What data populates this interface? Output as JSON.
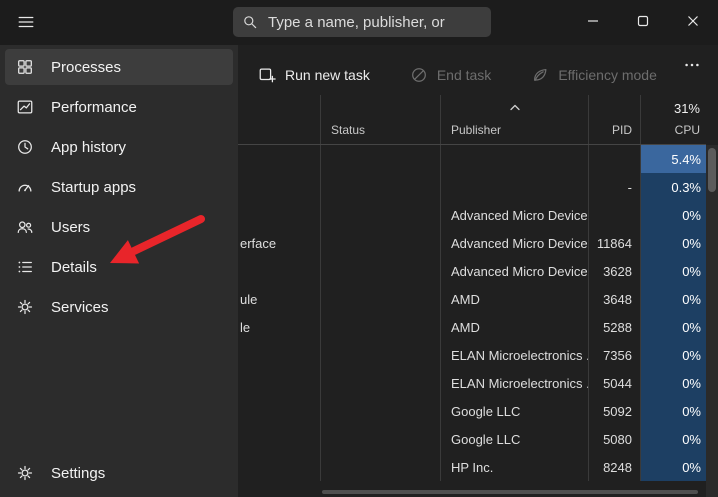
{
  "titlebar": {
    "search": {
      "placeholder": "Type a name, publisher, or"
    },
    "window_controls": [
      "minimize-icon",
      "maximize-icon",
      "close-icon"
    ]
  },
  "sidebar": {
    "items": [
      {
        "label": "Processes",
        "icon": "processes-icon",
        "selected": true
      },
      {
        "label": "Performance",
        "icon": "performance-icon",
        "selected": false
      },
      {
        "label": "App history",
        "icon": "app-history-icon",
        "selected": false
      },
      {
        "label": "Startup apps",
        "icon": "startup-apps-icon",
        "selected": false
      },
      {
        "label": "Users",
        "icon": "users-icon",
        "selected": false
      },
      {
        "label": "Details",
        "icon": "details-icon",
        "selected": false
      },
      {
        "label": "Services",
        "icon": "services-icon",
        "selected": false
      }
    ],
    "footer_item": {
      "label": "Settings",
      "icon": "settings-icon",
      "selected": false
    }
  },
  "toolbar": {
    "buttons": [
      {
        "label": "Run new task",
        "icon": "run-new-task-icon",
        "enabled": true
      },
      {
        "label": "End task",
        "icon": "end-task-icon",
        "enabled": false
      },
      {
        "label": "Efficiency mode",
        "icon": "efficiency-mode-icon",
        "enabled": false
      }
    ],
    "more_icon": "more-options-icon"
  },
  "table": {
    "sort": {
      "column": "Publisher",
      "direction": "ascending"
    },
    "cpu_header_percent": "31%",
    "columns": [
      {
        "key": "name",
        "label": ""
      },
      {
        "key": "status",
        "label": "Status"
      },
      {
        "key": "publisher",
        "label": "Publisher"
      },
      {
        "key": "pid",
        "label": "PID"
      },
      {
        "key": "cpu",
        "label": "CPU"
      }
    ],
    "rows": [
      {
        "name_fragment": "",
        "status": "",
        "publisher": "",
        "pid": "",
        "cpu": "5.4%",
        "cpu_heat": "high"
      },
      {
        "name_fragment": "",
        "status": "",
        "publisher": "",
        "pid": "-",
        "cpu": "0.3%",
        "cpu_heat": "low"
      },
      {
        "name_fragment": "",
        "status": "",
        "publisher": "Advanced Micro Device...",
        "pid": "",
        "cpu": "0%",
        "cpu_heat": "low"
      },
      {
        "name_fragment": "erface",
        "status": "",
        "publisher": "Advanced Micro Device...",
        "pid": "11864",
        "cpu": "0%",
        "cpu_heat": "low"
      },
      {
        "name_fragment": "",
        "status": "",
        "publisher": "Advanced Micro Device...",
        "pid": "3628",
        "cpu": "0%",
        "cpu_heat": "low"
      },
      {
        "name_fragment": "ule",
        "status": "",
        "publisher": "AMD",
        "pid": "3648",
        "cpu": "0%",
        "cpu_heat": "low"
      },
      {
        "name_fragment": "le",
        "status": "",
        "publisher": "AMD",
        "pid": "5288",
        "cpu": "0%",
        "cpu_heat": "low"
      },
      {
        "name_fragment": "",
        "status": "",
        "publisher": "ELAN Microelectronics ...",
        "pid": "7356",
        "cpu": "0%",
        "cpu_heat": "low"
      },
      {
        "name_fragment": "",
        "status": "",
        "publisher": "ELAN Microelectronics ...",
        "pid": "5044",
        "cpu": "0%",
        "cpu_heat": "low"
      },
      {
        "name_fragment": "",
        "status": "",
        "publisher": "Google LLC",
        "pid": "5092",
        "cpu": "0%",
        "cpu_heat": "low"
      },
      {
        "name_fragment": "",
        "status": "",
        "publisher": "Google LLC",
        "pid": "5080",
        "cpu": "0%",
        "cpu_heat": "low"
      },
      {
        "name_fragment": "",
        "status": "",
        "publisher": "HP Inc.",
        "pid": "8248",
        "cpu": "0%",
        "cpu_heat": "low"
      }
    ]
  },
  "annotation": {
    "type": "arrow",
    "points_to": "Details",
    "color": "#e8252a"
  },
  "colors": {
    "titlebar_bg": "#1c1c1c",
    "content_bg": "#202020",
    "sidebar_bg": "#2c2c2c",
    "selected_item_bg": "#3d3d3d",
    "cpu_column": "#1d3f63",
    "cpu_hot": "#3a679e",
    "arrow": "#e8252a"
  }
}
